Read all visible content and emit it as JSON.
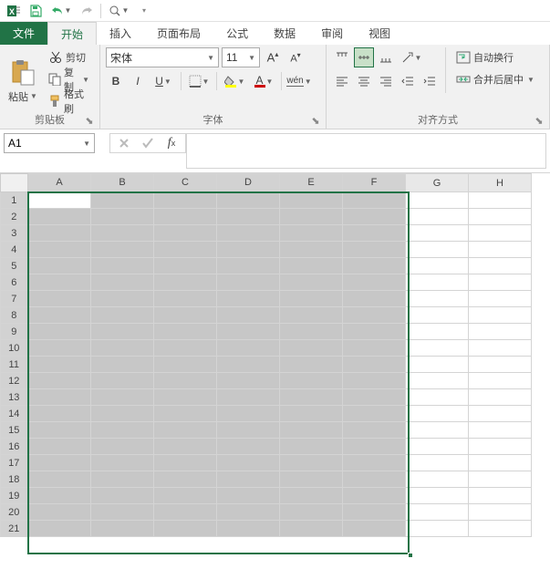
{
  "qat": {
    "undo": "↶",
    "redo": "↷"
  },
  "tabs": {
    "file": "文件",
    "home": "开始",
    "insert": "插入",
    "layout": "页面布局",
    "formulas": "公式",
    "data": "数据",
    "review": "审阅",
    "view": "视图"
  },
  "clipboard": {
    "paste": "粘贴",
    "cut": "剪切",
    "copy": "复制",
    "format_painter": "格式刷",
    "group": "剪贴板"
  },
  "font": {
    "name": "宋体",
    "size": "11",
    "bold": "B",
    "italic": "I",
    "underline": "U",
    "ruby": "wén",
    "group": "字体"
  },
  "align": {
    "wrap": "自动换行",
    "merge": "合并后居中",
    "group": "对齐方式"
  },
  "namebox": "A1",
  "selection": {
    "cols": [
      "A",
      "B",
      "C",
      "D",
      "E",
      "F",
      "G",
      "H"
    ],
    "selColStart": 0,
    "selColEnd": 5,
    "rows": 21,
    "selRowStart": 1,
    "selRowEnd": 21,
    "activeRow": 1,
    "activeCol": 0
  }
}
